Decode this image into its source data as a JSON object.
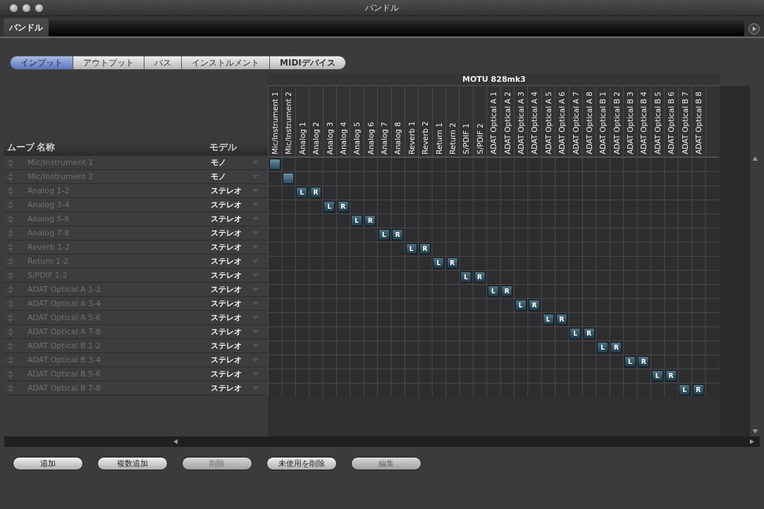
{
  "window": {
    "title": "バンドル"
  },
  "panel_tab": {
    "label": "バンドル"
  },
  "tabs": [
    {
      "label": "インプット",
      "selected": true
    },
    {
      "label": "アウトプット",
      "selected": false
    },
    {
      "label": "バス",
      "selected": false
    },
    {
      "label": "インストルメント",
      "selected": false
    },
    {
      "label": "MIDIデバイス",
      "selected": false
    }
  ],
  "table": {
    "header": {
      "move": "ムーブ",
      "name": "名称",
      "mode": "モデル"
    },
    "device": "MOTU 828mk3",
    "channels": [
      "Mic/Instrument 1",
      "Mic/Instrument 2",
      "Analog 1",
      "Analog 2",
      "Analog 3",
      "Analog 4",
      "Analog 5",
      "Analog 6",
      "Analog 7",
      "Analog 8",
      "Reverb 1",
      "Reverb 2",
      "Return 1",
      "Return 2",
      "S/PDIF 1",
      "S/PDIF 2",
      "ADAT Optical A 1",
      "ADAT Optical A 2",
      "ADAT Optical A 3",
      "ADAT Optical A 4",
      "ADAT Optical A 5",
      "ADAT Optical A 6",
      "ADAT Optical A 7",
      "ADAT Optical A 8",
      "ADAT Optical B 1",
      "ADAT Optical B 2",
      "ADAT Optical B 3",
      "ADAT Optical B 4",
      "ADAT Optical B 5",
      "ADAT Optical B 6",
      "ADAT Optical B 7",
      "ADAT Optical B 8"
    ],
    "rows": [
      {
        "name": "Mic/Instrument 1",
        "mode": "モノ",
        "kind": "mono"
      },
      {
        "name": "Mic/Instrument 2",
        "mode": "モノ",
        "kind": "mono"
      },
      {
        "name": "Analog 1-2",
        "mode": "ステレオ",
        "kind": "stereo",
        "patch_labels": [
          "L",
          "R"
        ]
      },
      {
        "name": "Analog 3-4",
        "mode": "ステレオ",
        "kind": "stereo",
        "patch_labels": [
          "L",
          "R"
        ]
      },
      {
        "name": "Analog 5-6",
        "mode": "ステレオ",
        "kind": "stereo",
        "patch_labels": [
          "L",
          "R"
        ]
      },
      {
        "name": "Analog 7-8",
        "mode": "ステレオ",
        "kind": "stereo",
        "patch_labels": [
          "L",
          "R"
        ]
      },
      {
        "name": "Reverb 1-2",
        "mode": "ステレオ",
        "kind": "stereo",
        "patch_labels": [
          "L",
          "R"
        ]
      },
      {
        "name": "Return 1-2",
        "mode": "ステレオ",
        "kind": "stereo",
        "patch_labels": [
          "L",
          "R"
        ]
      },
      {
        "name": "S/PDIF 1-2",
        "mode": "ステレオ",
        "kind": "stereo",
        "patch_labels": [
          "L",
          "R"
        ]
      },
      {
        "name": "ADAT Optical A 1-2",
        "mode": "ステレオ",
        "kind": "stereo",
        "patch_labels": [
          "L",
          "R"
        ]
      },
      {
        "name": "ADAT Optical A 3-4",
        "mode": "ステレオ",
        "kind": "stereo",
        "patch_labels": [
          "L",
          "R"
        ]
      },
      {
        "name": "ADAT Optical A 5-6",
        "mode": "ステレオ",
        "kind": "stereo",
        "patch_labels": [
          "L",
          "R"
        ]
      },
      {
        "name": "ADAT Optical A 7-8",
        "mode": "ステレオ",
        "kind": "stereo",
        "patch_labels": [
          "L",
          "R"
        ]
      },
      {
        "name": "ADAT Optical B 1-2",
        "mode": "ステレオ",
        "kind": "stereo",
        "patch_labels": [
          "L",
          "R"
        ]
      },
      {
        "name": "ADAT Optical B 3-4",
        "mode": "ステレオ",
        "kind": "stereo",
        "patch_labels": [
          "L",
          "R"
        ]
      },
      {
        "name": "ADAT Optical B 5-6",
        "mode": "ステレオ",
        "kind": "stereo",
        "patch_labels": [
          "L",
          "R"
        ]
      },
      {
        "name": "ADAT Optical B 7-8",
        "mode": "ステレオ",
        "kind": "stereo",
        "patch_labels": [
          "L",
          "R"
        ]
      }
    ]
  },
  "buttons": [
    {
      "label": "追加",
      "disabled": false
    },
    {
      "label": "複数追加",
      "disabled": false
    },
    {
      "label": "削除",
      "disabled": true
    },
    {
      "label": "未使用を削除",
      "disabled": false
    },
    {
      "label": "編集",
      "disabled": true
    }
  ]
}
